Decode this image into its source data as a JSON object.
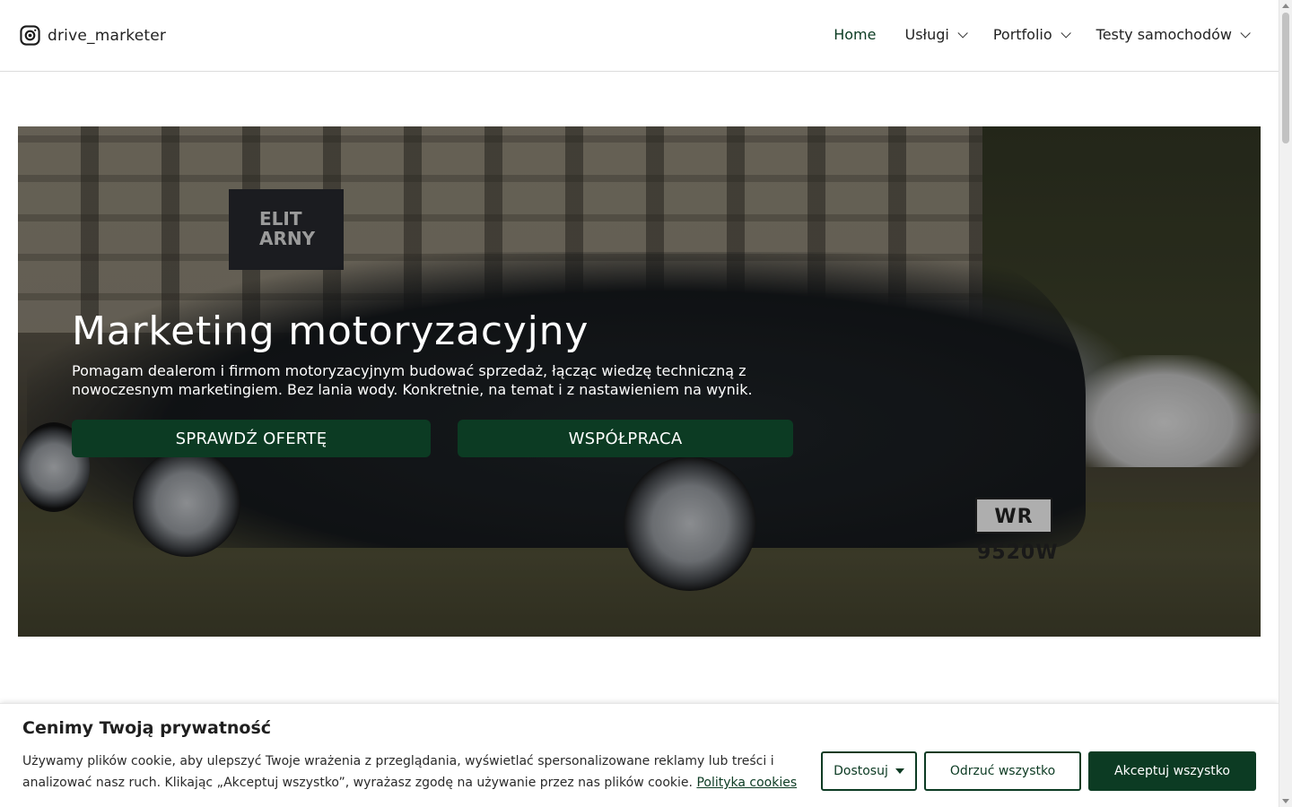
{
  "header": {
    "logo_text": "drive_marketer",
    "nav": [
      {
        "label": "Home"
      },
      {
        "label": "Usługi"
      },
      {
        "label": "Portfolio"
      },
      {
        "label": "Testy samochodów"
      }
    ]
  },
  "hero": {
    "title": "Marketing motoryzacyjny",
    "subtitle": "Pomagam dealerom i firmom motoryzacyjnym budować sprzedaż, łącząc wiedzę techniczną z nowoczesnym marketingiem. Bez lania wody. Konkretnie, na temat i z nastawieniem na wynik.",
    "buttons": {
      "offer": "SPRAWDŹ OFERTĘ",
      "cooperation": "WSPÓŁPRACA"
    },
    "image": {
      "banner_text": "ELIT ARNY",
      "plate_text": "WR 9520W"
    }
  },
  "cookie": {
    "title": "Cenimy Twoją prywatność",
    "text": "Używamy plików cookie, aby ulepszyć Twoje wrażenia z przeglądania, wyświetlać spersonalizowane reklamy lub treści i analizować nasz ruch. Klikając „Akceptuj wszystko”, wyrażasz zgodę na używanie przez nas plików cookie.",
    "link": "Polityka cookies",
    "buttons": {
      "customize": "Dostosuj",
      "reject": "Odrzuć wszystko",
      "accept": "Akceptuj wszystko"
    }
  },
  "colors": {
    "brand_green": "#0c3b23",
    "nav_active": "#0b3b22"
  }
}
